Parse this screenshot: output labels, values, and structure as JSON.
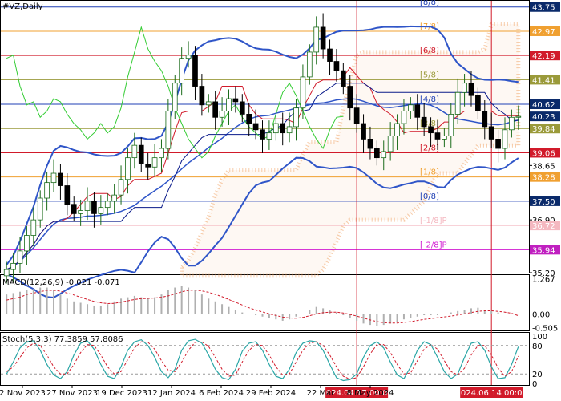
{
  "header": {
    "symbol_title": "#VZ,Daily",
    "macd_title": "MACD(12,26,9) -0.021 -0.071",
    "stoch_title": "Stoch(5,3,3) 77.3859 57.8086"
  },
  "chart_data": [
    {
      "type": "line",
      "panel": "price",
      "title": "#VZ,Daily",
      "ylim": [
        35.2,
        43.95
      ],
      "price_axis_ticks": [
        "43.75",
        "42.97",
        "42.19",
        "41.41",
        "40.62",
        "40.23",
        "39.84",
        "39.06",
        "38.65",
        "38.28",
        "37.50",
        "36.90",
        "36.72",
        "35.94",
        "35.20"
      ],
      "murrey_levels": [
        {
          "label": "[8/8]",
          "price": 43.75,
          "color": "#1f3fb4",
          "axis_fill": "#0a2a6a"
        },
        {
          "label": "[7/8]",
          "price": 42.97,
          "color": "#f0a030",
          "axis_fill": "#f0a030"
        },
        {
          "label": "[6/8]",
          "price": 42.19,
          "color": "#d11a2a",
          "axis_fill": "#d11a2a"
        },
        {
          "label": "[5/8]",
          "price": 41.41,
          "color": "#9a9a3a",
          "axis_fill": "#9a9a3a"
        },
        {
          "label": "[4/8]",
          "price": 40.62,
          "color": "#1f3fb4",
          "axis_fill": "#0a2a6a"
        },
        {
          "label": "[3/8]",
          "price": 39.84,
          "color": "#9a9a3a",
          "axis_fill": "#9a9a3a"
        },
        {
          "label": "[2/8]",
          "price": 39.06,
          "color": "#d11a2a",
          "axis_fill": "#d11a2a"
        },
        {
          "label": "[1/8]",
          "price": 38.28,
          "color": "#f0a030",
          "axis_fill": "#f0a030"
        },
        {
          "label": "[0/8]",
          "price": 37.5,
          "color": "#1f3fb4",
          "axis_fill": "#0a2a6a"
        },
        {
          "label": "[-1/8]P",
          "price": 36.72,
          "color": "#f4b8c0",
          "axis_fill": "#f4b8c0"
        },
        {
          "label": "[-2/8]P",
          "price": 35.94,
          "color": "#d11ad1",
          "axis_fill": "#c020c0"
        }
      ],
      "current_price": 40.23,
      "x_tick_labels": [
        "2 Nov 2023",
        "27 Nov 2023",
        "19 Dec 2023",
        "12 Jan 2024",
        "6 Feb 2024",
        "29 Feb 2024",
        "22 Mar",
        "8 May 2024"
      ],
      "vertical_markers": [
        {
          "label": "2024.04.17 00:00",
          "color": "#d11a2a"
        },
        {
          "label": "2024.06.14 00:00",
          "color": "#d11a2a"
        }
      ],
      "close_series": [
        35.3,
        35.5,
        35.9,
        36.4,
        36.9,
        37.6,
        38.1,
        38.4,
        38.0,
        37.4,
        37.1,
        37.2,
        37.5,
        37.1,
        37.3,
        37.5,
        37.7,
        38.2,
        38.9,
        39.3,
        38.7,
        38.6,
        38.9,
        39.2,
        40.4,
        41.3,
        42.1,
        42.2,
        41.2,
        40.6,
        40.7,
        40.2,
        40.4,
        40.8,
        40.7,
        40.3,
        40.0,
        39.8,
        39.5,
        39.7,
        40.0,
        39.7,
        39.9,
        40.5,
        41.5,
        42.3,
        43.1,
        42.4,
        42.0,
        41.7,
        41.2,
        40.5,
        40.0,
        39.5,
        39.2,
        38.9,
        39.1,
        39.6,
        40.0,
        40.4,
        40.6,
        40.2,
        39.9,
        39.7,
        39.5,
        39.6,
        40.3,
        41.0,
        41.3,
        40.9,
        40.4,
        39.9,
        39.5,
        39.2,
        39.8,
        40.2,
        40.23
      ]
    },
    {
      "type": "bar",
      "panel": "macd",
      "title": "MACD(12,26,9) -0.021 -0.071",
      "series": [
        {
          "name": "MACD",
          "values": [
            0.7,
            0.75,
            0.8,
            0.85,
            0.9,
            0.95,
            0.95,
            0.85,
            0.7,
            0.55,
            0.45,
            0.4,
            0.35,
            0.3,
            0.3,
            0.35,
            0.45,
            0.55,
            0.6,
            0.65,
            0.6,
            0.55,
            0.6,
            0.7,
            0.85,
            0.95,
            1.0,
            0.95,
            0.85,
            0.7,
            0.55,
            0.45,
            0.35,
            0.25,
            0.15,
            0.05,
            0.0,
            -0.05,
            -0.1,
            -0.15,
            -0.2,
            -0.25,
            -0.2,
            -0.1,
            0.0,
            0.15,
            0.25,
            0.2,
            0.15,
            0.05,
            -0.05,
            -0.15,
            -0.25,
            -0.35,
            -0.4,
            -0.45,
            -0.4,
            -0.35,
            -0.3,
            -0.2,
            -0.15,
            -0.1,
            -0.05,
            -0.05,
            -0.05,
            0.0,
            0.05,
            0.1,
            0.15,
            0.2,
            0.22,
            0.15,
            0.1,
            0.05,
            0.0,
            -0.01,
            -0.021
          ]
        }
      ],
      "signal": [
        0.5,
        0.55,
        0.6,
        0.7,
        0.75,
        0.8,
        0.85,
        0.85,
        0.82,
        0.75,
        0.68,
        0.6,
        0.52,
        0.45,
        0.4,
        0.37,
        0.38,
        0.42,
        0.47,
        0.52,
        0.55,
        0.56,
        0.57,
        0.6,
        0.65,
        0.72,
        0.8,
        0.85,
        0.86,
        0.83,
        0.78,
        0.7,
        0.62,
        0.52,
        0.42,
        0.32,
        0.22,
        0.14,
        0.07,
        0.0,
        -0.06,
        -0.12,
        -0.15,
        -0.16,
        -0.13,
        -0.07,
        0.0,
        0.04,
        0.06,
        0.06,
        0.03,
        -0.02,
        -0.08,
        -0.15,
        -0.22,
        -0.28,
        -0.32,
        -0.33,
        -0.33,
        -0.31,
        -0.28,
        -0.24,
        -0.2,
        -0.17,
        -0.14,
        -0.11,
        -0.08,
        -0.04,
        0.0,
        0.05,
        0.09,
        0.11,
        0.11,
        0.09,
        0.06,
        0.02,
        -0.071
      ],
      "axis_ticks": [
        "1.267",
        "0.00",
        "-0.505"
      ],
      "ylim": [
        -0.6,
        1.4
      ]
    },
    {
      "type": "line",
      "panel": "stochastic",
      "title": "Stoch(5,3,3) 77.3859 57.8086",
      "series": [
        {
          "name": "%K",
          "values": [
            20,
            45,
            75,
            88,
            90,
            70,
            40,
            18,
            10,
            25,
            60,
            85,
            90,
            72,
            40,
            15,
            10,
            35,
            70,
            88,
            92,
            80,
            55,
            25,
            12,
            30,
            70,
            90,
            93,
            85,
            60,
            30,
            12,
            8,
            30,
            68,
            85,
            88,
            70,
            40,
            15,
            10,
            30,
            65,
            85,
            90,
            88,
            70,
            40,
            12,
            6,
            8,
            20,
            55,
            80,
            88,
            75,
            45,
            18,
            10,
            35,
            70,
            88,
            82,
            55,
            25,
            10,
            20,
            55,
            85,
            88,
            70,
            35,
            10,
            12,
            40,
            77.4
          ]
        },
        {
          "name": "%D",
          "values": [
            25,
            35,
            55,
            75,
            85,
            80,
            60,
            35,
            20,
            20,
            40,
            65,
            82,
            80,
            60,
            35,
            20,
            25,
            50,
            75,
            88,
            87,
            72,
            48,
            28,
            25,
            45,
            70,
            87,
            88,
            78,
            55,
            30,
            15,
            18,
            45,
            70,
            82,
            80,
            60,
            35,
            18,
            20,
            45,
            70,
            85,
            88,
            80,
            60,
            35,
            15,
            9,
            12,
            35,
            62,
            82,
            82,
            65,
            40,
            20,
            22,
            48,
            72,
            82,
            72,
            48,
            25,
            18,
            32,
            60,
            80,
            80,
            60,
            32,
            15,
            25,
            57.8
          ]
        }
      ],
      "axis_ticks": [
        "100",
        "80",
        "20",
        "0"
      ],
      "ylim": [
        0,
        100
      ]
    }
  ],
  "colors": {
    "up_candle": "#1a6b1a",
    "down_candle": "#000000",
    "bollinger": "#2f55c8",
    "tenkan": "#d11a2a",
    "kijun": "#0a1a8a",
    "chikou": "#33cc33",
    "kumo": "#f0a060",
    "stoch_main": "#2aa6a6",
    "stoch_signal": "#d11a2a"
  }
}
